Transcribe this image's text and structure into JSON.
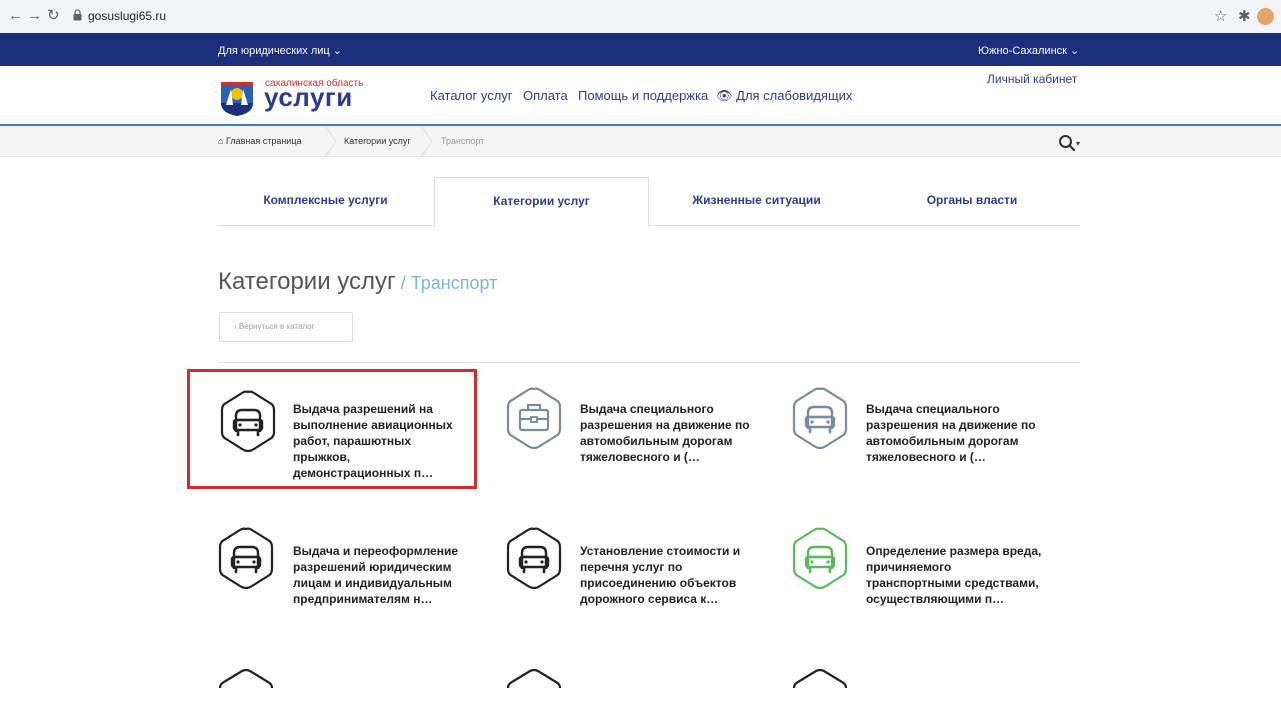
{
  "browser": {
    "url": "gosuslugi65.ru"
  },
  "topbar": {
    "left_label": "Для юридических лиц ⌄",
    "right_label": "Южно-Сахалинск ⌄"
  },
  "header": {
    "logo_region": "сахалинская область",
    "logo_word": "услуги",
    "nav": [
      "Каталог услуг",
      "Оплата",
      "Помощь и поддержка",
      "Для слабовидящих"
    ],
    "cabinet": "Личный кабинет"
  },
  "breadcrumb": {
    "home": "Главная страница",
    "level1": "Категории услуг",
    "level2": "Транспорт"
  },
  "tabs": [
    {
      "label": "Комплексные услуги",
      "active": false
    },
    {
      "label": "Категории услуг",
      "active": true
    },
    {
      "label": "Жизненные ситуации",
      "active": false
    },
    {
      "label": "Органы власти",
      "active": false
    }
  ],
  "page": {
    "title": "Категории услуг",
    "separator": " / ",
    "subtitle": "Транспорт",
    "back_label": "Вернуться в каталог"
  },
  "cards": [
    {
      "text": "Выдача разрешений на выполнение авиационных работ, парашютных прыжков, демонстрационных п…",
      "icon": "car-icon",
      "color": "#222222",
      "highlighted": true
    },
    {
      "text": "Выдача специального разрешения на движение по автомобильным дорогам тяжеловесного и (…",
      "icon": "briefcase-icon",
      "color": "#7a8a99",
      "highlighted": false
    },
    {
      "text": "Выдача специального разрешения на движение по автомобильным дорогам тяжеловесного и (…",
      "icon": "car-icon",
      "color": "#7a8a99",
      "highlighted": false
    },
    {
      "text": "Выдача и переоформление разрешений юридическим лицам и индивидуальным предпринимателям н…",
      "icon": "car-icon",
      "color": "#222222",
      "highlighted": false
    },
    {
      "text": "Установление стоимости и перечня услуг по присоединению объектов дорожного сервиса к…",
      "icon": "car-icon",
      "color": "#222222",
      "highlighted": false
    },
    {
      "text": "Определение размера вреда, причиняемого транспортными средствами, осуществляющими п…",
      "icon": "car-icon",
      "color": "#5cb85c",
      "highlighted": false
    }
  ],
  "colors": {
    "topbar": "#1b2f7a",
    "brand": "#2d3b8f",
    "highlight": "#d62b2b",
    "subtitle": "#7fb3d5"
  }
}
